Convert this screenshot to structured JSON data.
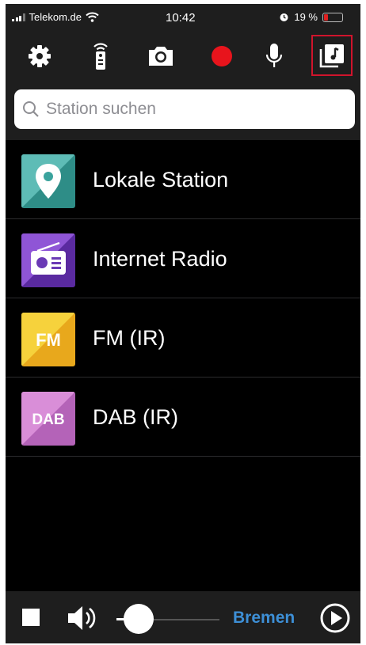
{
  "status_bar": {
    "carrier": "Telekom.de",
    "time": "10:42",
    "battery_percent": "19 %",
    "battery_level": 0.19
  },
  "toolbar": {
    "icons": [
      "gear-icon",
      "remote-icon",
      "camera-icon",
      "record-icon",
      "microphone-icon",
      "music-library-icon"
    ],
    "selected": "music-library-icon",
    "record_color": "#e8141c",
    "highlight_color": "#d0142c"
  },
  "search": {
    "placeholder": "Station suchen",
    "value": ""
  },
  "stations": [
    {
      "label": "Lokale Station",
      "icon": "location-pin-icon",
      "colors": [
        "#5ebcb6",
        "#2e8d87"
      ]
    },
    {
      "label": "Internet Radio",
      "icon": "radio-icon",
      "colors": [
        "#8f55d6",
        "#5a2aa0"
      ]
    },
    {
      "label": "FM (IR)",
      "icon": "fm-icon",
      "badge": "FM",
      "colors": [
        "#f6d23c",
        "#e8a81c"
      ]
    },
    {
      "label": "DAB (IR)",
      "icon": "dab-icon",
      "badge": "DAB",
      "colors": [
        "#d98ed8",
        "#b463b8"
      ]
    }
  ],
  "player": {
    "station": "Bremen",
    "volume": 0.18,
    "accent_color": "#3d8fd6"
  }
}
